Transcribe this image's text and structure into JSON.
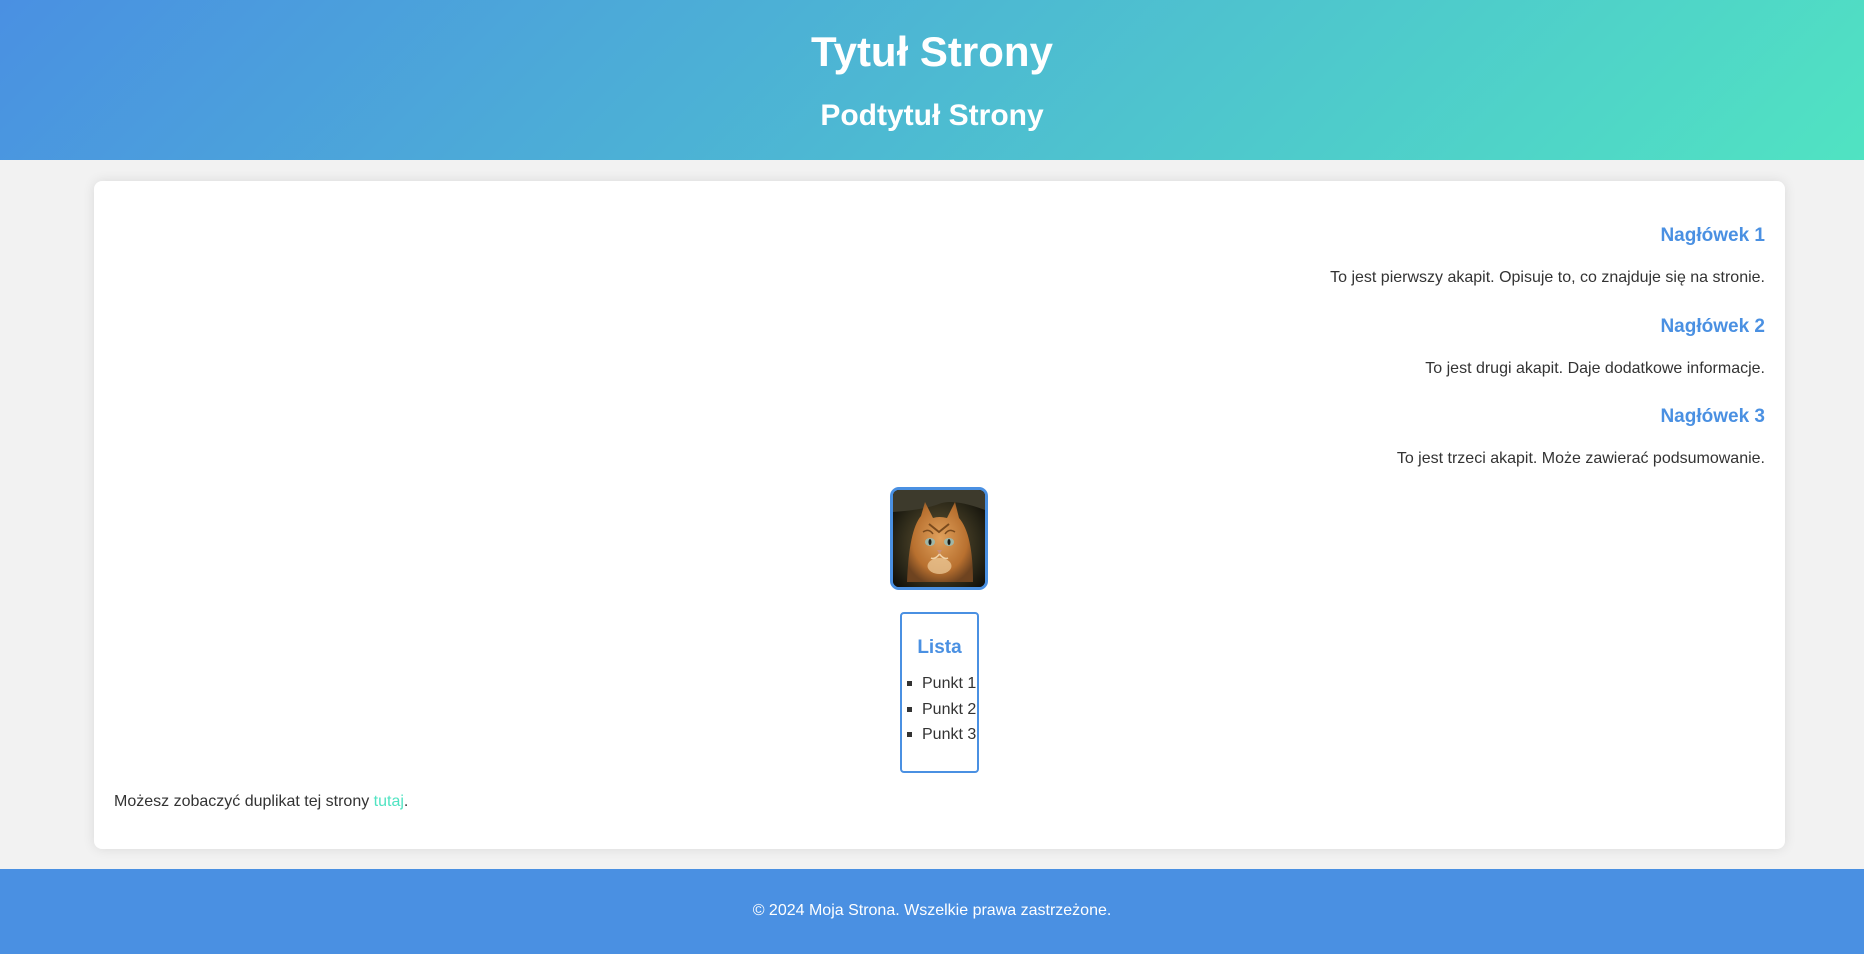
{
  "header": {
    "title": "Tytuł Strony",
    "subtitle": "Podtytuł Strony"
  },
  "sections": [
    {
      "heading": "Nagłówek 1",
      "text": "To jest pierwszy akapit. Opisuje to, co znajduje się na stronie."
    },
    {
      "heading": "Nagłówek 2",
      "text": "To jest drugi akapit. Daje dodatkowe informacje."
    },
    {
      "heading": "Nagłówek 3",
      "text": "To jest trzeci akapit. Może zawierać podsumowanie."
    }
  ],
  "image": {
    "subject": "cat-photo"
  },
  "list": {
    "title": "Lista",
    "items": [
      "Punkt 1",
      "Punkt 2",
      "Punkt 3"
    ]
  },
  "note": {
    "text": "Możesz zobaczyć duplikat tej strony ",
    "link_label": "tutaj",
    "suffix": "."
  },
  "footer": {
    "text": "© 2024 Moja Strona. Wszelkie prawa zastrzeżone."
  },
  "colors": {
    "primary": "#4a90e2",
    "accent": "#50e3c2",
    "background": "#f2f2f2",
    "card": "#ffffff",
    "text": "#333333"
  }
}
